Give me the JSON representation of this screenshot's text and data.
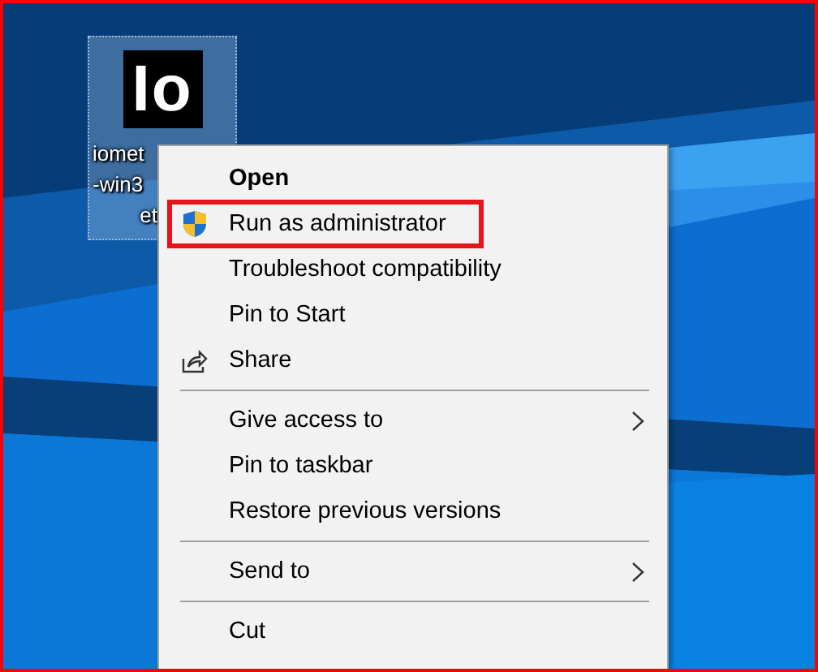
{
  "desktop_icon": {
    "logo_text": "Io",
    "label_lines": [
      "iomet",
      "-win3",
      "et"
    ],
    "selected": true
  },
  "context_menu": {
    "items": [
      {
        "kind": "plain",
        "label": "Open",
        "default": true,
        "submenu": false,
        "highlighted": false
      },
      {
        "kind": "shield",
        "label": "Run as administrator",
        "default": false,
        "submenu": false,
        "highlighted": true
      },
      {
        "kind": "plain",
        "label": "Troubleshoot compatibility",
        "default": false,
        "submenu": false,
        "highlighted": false
      },
      {
        "kind": "plain",
        "label": "Pin to Start",
        "default": false,
        "submenu": false,
        "highlighted": false
      },
      {
        "kind": "share",
        "label": "Share",
        "default": false,
        "submenu": false,
        "highlighted": false
      },
      {
        "kind": "separator"
      },
      {
        "kind": "plain",
        "label": "Give access to",
        "default": false,
        "submenu": true,
        "highlighted": false
      },
      {
        "kind": "plain",
        "label": "Pin to taskbar",
        "default": false,
        "submenu": false,
        "highlighted": false
      },
      {
        "kind": "plain",
        "label": "Restore previous versions",
        "default": false,
        "submenu": false,
        "highlighted": false
      },
      {
        "kind": "separator"
      },
      {
        "kind": "plain",
        "label": "Send to",
        "default": false,
        "submenu": true,
        "highlighted": false
      },
      {
        "kind": "separator"
      },
      {
        "kind": "plain",
        "label": "Cut",
        "default": false,
        "submenu": false,
        "highlighted": false
      }
    ]
  }
}
